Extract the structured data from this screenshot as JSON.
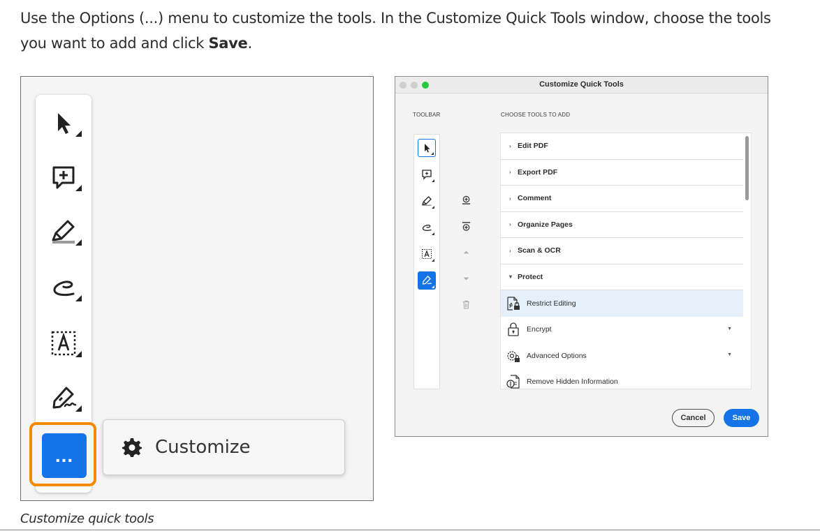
{
  "intro": {
    "part1": "Use the Options (...) menu to customize the tools. In the Customize Quick Tools window, choose the tools you want to add and click ",
    "bold": "Save",
    "part2": "."
  },
  "left_figure": {
    "tools": [
      "select-tool",
      "add-comment-tool",
      "highlight-tool",
      "draw-tool",
      "add-text-tool",
      "sign-tool"
    ],
    "more_button": "...",
    "customize_label": "Customize"
  },
  "caption": "Customize quick tools",
  "dialog": {
    "title": "Customize Quick Tools",
    "toolbar_label": "TOOLBAR",
    "choose_label": "CHOOSE TOOLS TO ADD",
    "categories": [
      {
        "label": "Edit PDF",
        "expanded": false
      },
      {
        "label": "Export PDF",
        "expanded": false
      },
      {
        "label": "Comment",
        "expanded": false
      },
      {
        "label": "Organize Pages",
        "expanded": false
      },
      {
        "label": "Scan & OCR",
        "expanded": false
      },
      {
        "label": "Protect",
        "expanded": true
      }
    ],
    "protect_tools": [
      {
        "label": "Restrict Editing",
        "icon": "restrict-editing-icon",
        "selected": true,
        "dropdown": false
      },
      {
        "label": "Encrypt",
        "icon": "lock-icon",
        "selected": false,
        "dropdown": true
      },
      {
        "label": "Advanced Options",
        "icon": "advanced-options-icon",
        "selected": false,
        "dropdown": true
      },
      {
        "label": "Remove Hidden Information",
        "icon": "remove-hidden-info-icon",
        "selected": false,
        "dropdown": false
      }
    ],
    "cancel_label": "Cancel",
    "save_label": "Save",
    "accent_color": "#1473e6"
  },
  "highlight_color": "#f28b00"
}
